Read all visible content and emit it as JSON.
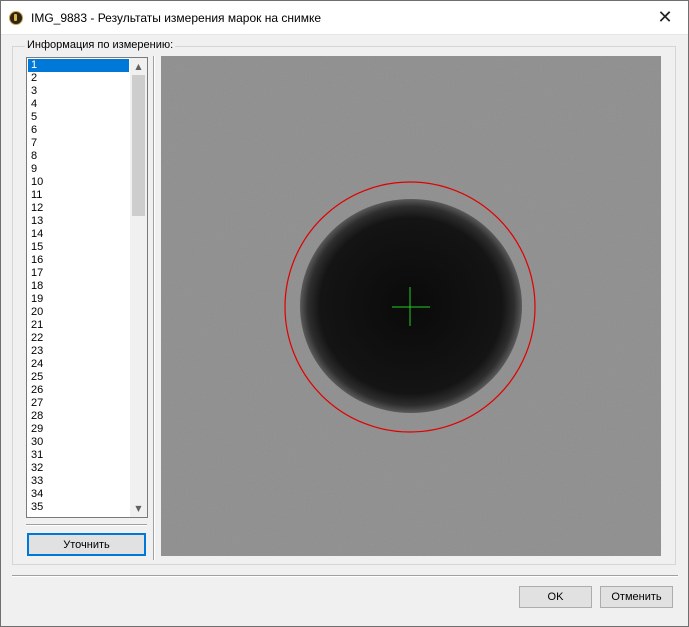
{
  "window": {
    "title": "IMG_9883 - Результаты измерения марок на снимке",
    "close_glyph": "✕",
    "icon": "app-icon"
  },
  "info_group": {
    "label": "Информация по измерению:"
  },
  "measurement_list": {
    "items": [
      "1",
      "2",
      "3",
      "4",
      "5",
      "6",
      "7",
      "8",
      "9",
      "10",
      "11",
      "12",
      "13",
      "14",
      "15",
      "16",
      "17",
      "18",
      "19",
      "20",
      "21",
      "22",
      "23",
      "24",
      "25",
      "26",
      "27",
      "28",
      "29",
      "30",
      "31",
      "32",
      "33",
      "34",
      "35"
    ],
    "selected_index": 0,
    "scroll_up_glyph": "▲",
    "scroll_down_glyph": "▼"
  },
  "buttons": {
    "refine_label": "Уточнить",
    "ok_label": "OK",
    "cancel_label": "Отменить"
  },
  "viewer": {
    "background_color": "#8f8f8f",
    "mark_color": "#0d0d0d",
    "fit_circle_color": "#e00000",
    "crosshair_color": "#22cc22"
  }
}
